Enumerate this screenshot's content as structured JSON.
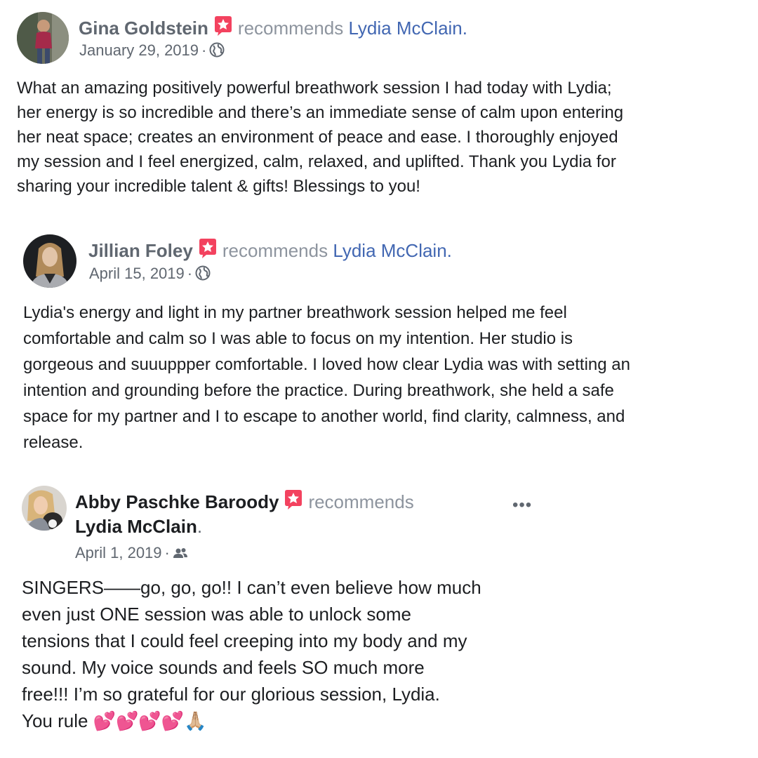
{
  "colors": {
    "link": "#4267b2",
    "meta": "#606770",
    "recommends": "#8d949e",
    "badge": "#f3425f"
  },
  "posts": [
    {
      "author": "Gina Goldstein",
      "recommends": "recommends",
      "target": "Lydia McClain",
      "target_suffix": ".",
      "date": "January 29, 2019",
      "separator": "·",
      "privacy_icon": "globe-icon",
      "badge_icon": "recommendation-star-icon",
      "text": "What an amazing positively powerful breathwork session I had today with Lydia;\nher energy is so incredible and there’s an immediate sense of calm upon entering\nher neat space; creates an environment of peace and ease. I thoroughly enjoyed\nmy session and I feel energized, calm, relaxed, and uplifted. Thank you Lydia for\nsharing your incredible talent & gifts! Blessings to you!"
    },
    {
      "author": "Jillian Foley",
      "recommends": "recommends",
      "target": "Lydia McClain",
      "target_suffix": ".",
      "date": "April 15, 2019",
      "separator": "·",
      "privacy_icon": "globe-icon",
      "badge_icon": "recommendation-star-icon",
      "text": "Lydia's energy and light in my partner breathwork session helped me feel\ncomfortable and calm so I was able to focus on my intention. Her studio is\ngorgeous and suuuppper comfortable. I loved how clear Lydia was with setting an\nintention and grounding before the practice. During breathwork, she held a safe\nspace for my partner and I to escape to another world, find clarity, calmness, and\nrelease."
    },
    {
      "author": "Abby Paschke Baroody",
      "recommends": "recommends",
      "target": "Lydia McClain",
      "target_suffix": ".",
      "date": "April 1, 2019",
      "separator": "·",
      "privacy_icon": "friends-icon",
      "badge_icon": "recommendation-star-icon",
      "more_label": "•••",
      "text": "SINGERS——go, go, go!! I can’t even believe how much\neven just ONE session was able to unlock some\ntensions that I could feel creeping into my body and my\nsound. My voice sounds and feels SO much more\nfree!!! I’m so grateful for our glorious session, Lydia.\nYou rule 💕💕💕💕🙏🏼"
    }
  ]
}
